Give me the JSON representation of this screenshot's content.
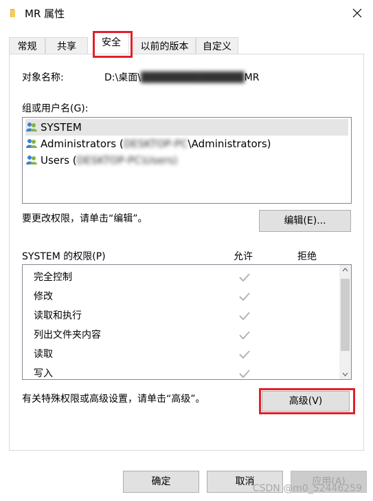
{
  "window": {
    "title": "MR 属性",
    "close_label": "关闭"
  },
  "tabs": [
    {
      "label": "常规"
    },
    {
      "label": "共享"
    },
    {
      "label": "安全",
      "active": true
    },
    {
      "label": "以前的版本"
    },
    {
      "label": "自定义"
    }
  ],
  "security": {
    "object_label": "对象名称:",
    "object_value_prefix": "D:\\桌面\\",
    "object_value_tail": "MR",
    "groups_label": "组或用户名(G):",
    "groups": [
      {
        "name": "SYSTEM",
        "selected": true
      },
      {
        "name_prefix": "Administrators (",
        "name_hidden": "DESKTOP-PC",
        "name_suffix": "\\Administrators)"
      },
      {
        "name_prefix": "Users (",
        "name_hidden": "DESKTOP-PC",
        "name_suffix": "\\Users)"
      }
    ],
    "edit_hint": "要更改权限，请单击“编辑”。",
    "edit_button": "编辑(E)...",
    "perm_header": "SYSTEM 的权限(P)",
    "allow_header": "允许",
    "deny_header": "拒绝",
    "permissions": [
      {
        "name": "完全控制",
        "allow": true
      },
      {
        "name": "修改",
        "allow": true
      },
      {
        "name": "读取和执行",
        "allow": true
      },
      {
        "name": "列出文件夹内容",
        "allow": true
      },
      {
        "name": "读取",
        "allow": true
      },
      {
        "name": "写入",
        "allow": true
      }
    ],
    "advanced_hint": "有关特殊权限或高级设置，请单击“高级”。",
    "advanced_button": "高级(V)"
  },
  "footer": {
    "ok": "确定",
    "cancel": "取消",
    "apply": "应用(A)"
  },
  "watermark": "CSDN @m0_52446259",
  "colors": {
    "highlight": "#e0202b",
    "check": "#b4b4b4"
  }
}
